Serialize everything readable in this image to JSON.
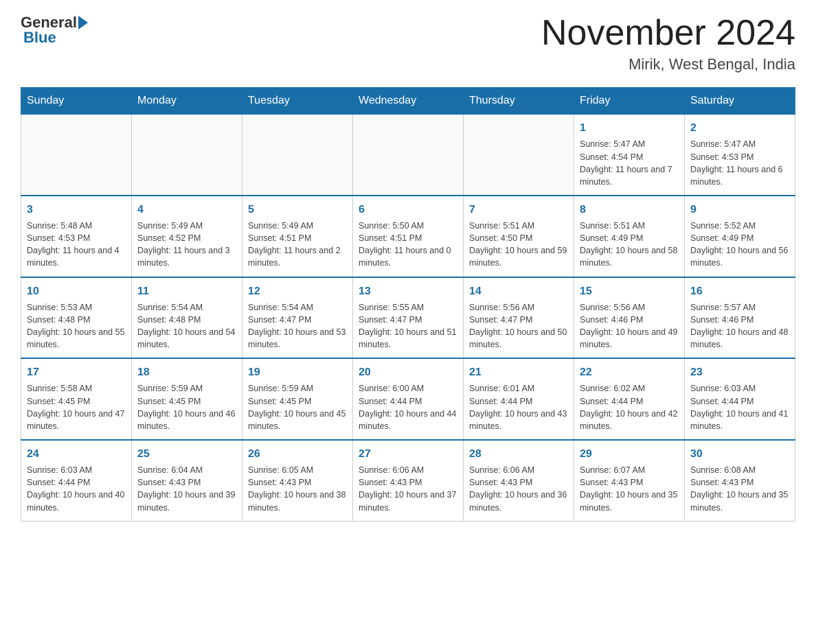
{
  "header": {
    "logo_general": "General",
    "logo_blue": "Blue",
    "month_title": "November 2024",
    "location": "Mirik, West Bengal, India"
  },
  "days_of_week": [
    "Sunday",
    "Monday",
    "Tuesday",
    "Wednesday",
    "Thursday",
    "Friday",
    "Saturday"
  ],
  "weeks": [
    [
      {
        "day": "",
        "info": ""
      },
      {
        "day": "",
        "info": ""
      },
      {
        "day": "",
        "info": ""
      },
      {
        "day": "",
        "info": ""
      },
      {
        "day": "",
        "info": ""
      },
      {
        "day": "1",
        "info": "Sunrise: 5:47 AM\nSunset: 4:54 PM\nDaylight: 11 hours and 7 minutes."
      },
      {
        "day": "2",
        "info": "Sunrise: 5:47 AM\nSunset: 4:53 PM\nDaylight: 11 hours and 6 minutes."
      }
    ],
    [
      {
        "day": "3",
        "info": "Sunrise: 5:48 AM\nSunset: 4:53 PM\nDaylight: 11 hours and 4 minutes."
      },
      {
        "day": "4",
        "info": "Sunrise: 5:49 AM\nSunset: 4:52 PM\nDaylight: 11 hours and 3 minutes."
      },
      {
        "day": "5",
        "info": "Sunrise: 5:49 AM\nSunset: 4:51 PM\nDaylight: 11 hours and 2 minutes."
      },
      {
        "day": "6",
        "info": "Sunrise: 5:50 AM\nSunset: 4:51 PM\nDaylight: 11 hours and 0 minutes."
      },
      {
        "day": "7",
        "info": "Sunrise: 5:51 AM\nSunset: 4:50 PM\nDaylight: 10 hours and 59 minutes."
      },
      {
        "day": "8",
        "info": "Sunrise: 5:51 AM\nSunset: 4:49 PM\nDaylight: 10 hours and 58 minutes."
      },
      {
        "day": "9",
        "info": "Sunrise: 5:52 AM\nSunset: 4:49 PM\nDaylight: 10 hours and 56 minutes."
      }
    ],
    [
      {
        "day": "10",
        "info": "Sunrise: 5:53 AM\nSunset: 4:48 PM\nDaylight: 10 hours and 55 minutes."
      },
      {
        "day": "11",
        "info": "Sunrise: 5:54 AM\nSunset: 4:48 PM\nDaylight: 10 hours and 54 minutes."
      },
      {
        "day": "12",
        "info": "Sunrise: 5:54 AM\nSunset: 4:47 PM\nDaylight: 10 hours and 53 minutes."
      },
      {
        "day": "13",
        "info": "Sunrise: 5:55 AM\nSunset: 4:47 PM\nDaylight: 10 hours and 51 minutes."
      },
      {
        "day": "14",
        "info": "Sunrise: 5:56 AM\nSunset: 4:47 PM\nDaylight: 10 hours and 50 minutes."
      },
      {
        "day": "15",
        "info": "Sunrise: 5:56 AM\nSunset: 4:46 PM\nDaylight: 10 hours and 49 minutes."
      },
      {
        "day": "16",
        "info": "Sunrise: 5:57 AM\nSunset: 4:46 PM\nDaylight: 10 hours and 48 minutes."
      }
    ],
    [
      {
        "day": "17",
        "info": "Sunrise: 5:58 AM\nSunset: 4:45 PM\nDaylight: 10 hours and 47 minutes."
      },
      {
        "day": "18",
        "info": "Sunrise: 5:59 AM\nSunset: 4:45 PM\nDaylight: 10 hours and 46 minutes."
      },
      {
        "day": "19",
        "info": "Sunrise: 5:59 AM\nSunset: 4:45 PM\nDaylight: 10 hours and 45 minutes."
      },
      {
        "day": "20",
        "info": "Sunrise: 6:00 AM\nSunset: 4:44 PM\nDaylight: 10 hours and 44 minutes."
      },
      {
        "day": "21",
        "info": "Sunrise: 6:01 AM\nSunset: 4:44 PM\nDaylight: 10 hours and 43 minutes."
      },
      {
        "day": "22",
        "info": "Sunrise: 6:02 AM\nSunset: 4:44 PM\nDaylight: 10 hours and 42 minutes."
      },
      {
        "day": "23",
        "info": "Sunrise: 6:03 AM\nSunset: 4:44 PM\nDaylight: 10 hours and 41 minutes."
      }
    ],
    [
      {
        "day": "24",
        "info": "Sunrise: 6:03 AM\nSunset: 4:44 PM\nDaylight: 10 hours and 40 minutes."
      },
      {
        "day": "25",
        "info": "Sunrise: 6:04 AM\nSunset: 4:43 PM\nDaylight: 10 hours and 39 minutes."
      },
      {
        "day": "26",
        "info": "Sunrise: 6:05 AM\nSunset: 4:43 PM\nDaylight: 10 hours and 38 minutes."
      },
      {
        "day": "27",
        "info": "Sunrise: 6:06 AM\nSunset: 4:43 PM\nDaylight: 10 hours and 37 minutes."
      },
      {
        "day": "28",
        "info": "Sunrise: 6:06 AM\nSunset: 4:43 PM\nDaylight: 10 hours and 36 minutes."
      },
      {
        "day": "29",
        "info": "Sunrise: 6:07 AM\nSunset: 4:43 PM\nDaylight: 10 hours and 35 minutes."
      },
      {
        "day": "30",
        "info": "Sunrise: 6:08 AM\nSunset: 4:43 PM\nDaylight: 10 hours and 35 minutes."
      }
    ]
  ]
}
